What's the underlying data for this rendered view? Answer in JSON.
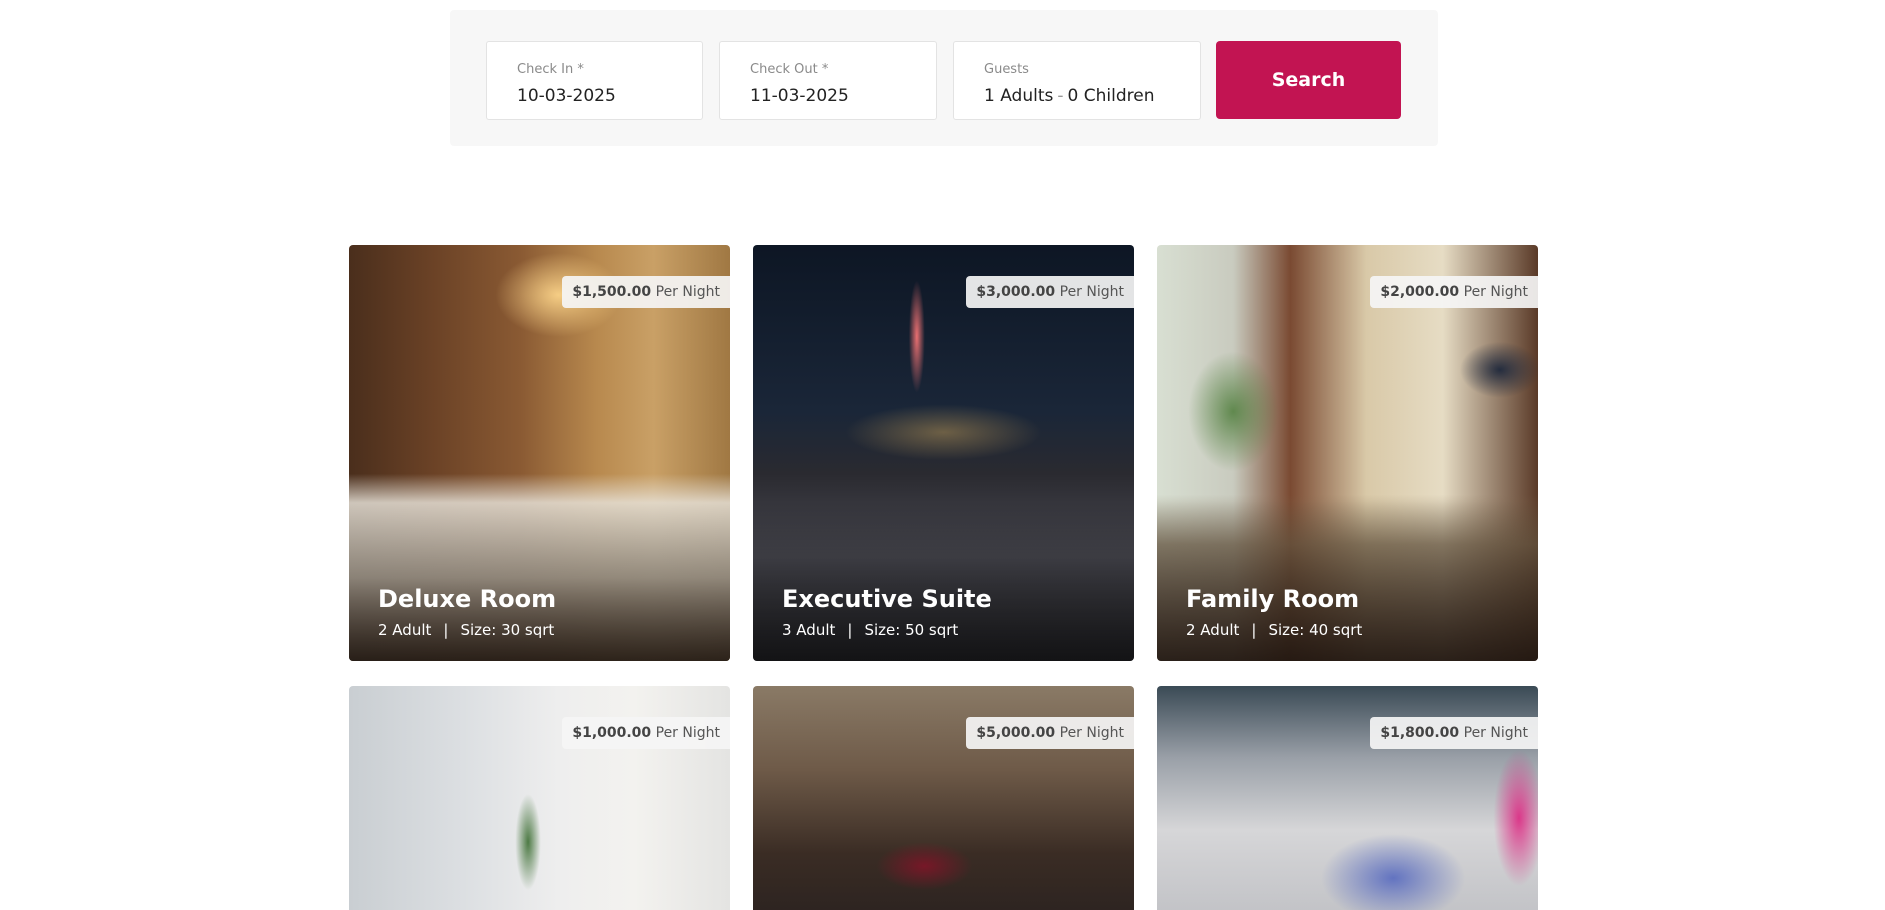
{
  "search": {
    "check_in_label": "Check In *",
    "check_in_value": "10-03-2025",
    "check_out_label": "Check Out *",
    "check_out_value": "11-03-2025",
    "guests_label": "Guests",
    "guests_adults": "1 Adults",
    "guests_separator": "-",
    "guests_children": "0 Children",
    "button_label": "Search",
    "accent_color": "#c21452"
  },
  "rooms": [
    {
      "price": "$1,500.00",
      "unit": "Per Night",
      "name": "Deluxe Room",
      "guests": "2 Adult",
      "size": "Size: 30 sqrt"
    },
    {
      "price": "$3,000.00",
      "unit": "Per Night",
      "name": "Executive Suite",
      "guests": "3 Adult",
      "size": "Size: 50 sqrt"
    },
    {
      "price": "$2,000.00",
      "unit": "Per Night",
      "name": "Family Room",
      "guests": "2 Adult",
      "size": "Size: 40 sqrt"
    },
    {
      "price": "$1,000.00",
      "unit": "Per Night"
    },
    {
      "price": "$5,000.00",
      "unit": "Per Night"
    },
    {
      "price": "$1,800.00",
      "unit": "Per Night"
    }
  ],
  "meta_separator": "|"
}
